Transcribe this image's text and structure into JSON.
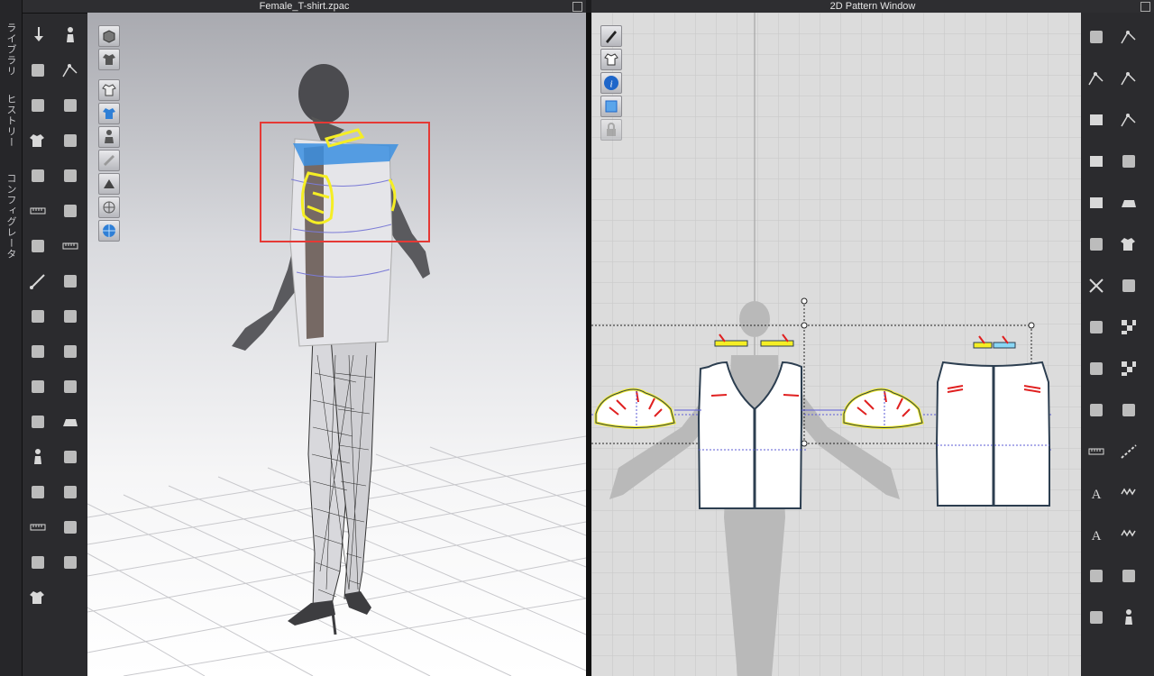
{
  "side_tabs": [
    {
      "label": "ライブラリ"
    },
    {
      "label": "ヒストリー"
    },
    {
      "label": "コンフィグレータ"
    }
  ],
  "windows": {
    "left_title": "Female_T-shirt.zpac",
    "right_title": "2D Pattern Window"
  },
  "colors": {
    "app_bg": "#1d1d1f",
    "toolbar_bg": "#2b2b2e",
    "selection_box": "#e53935",
    "seam_highlight": "#f5ee24",
    "pattern_fill": "#ffffff",
    "pattern_outline": "#2c3e50",
    "notch_red": "#e02020",
    "grid_bg": "#dcdcdc"
  },
  "left_toolbar_icons": [
    "move-down-icon",
    "walk-figure-icon",
    "pin-hand-icon",
    "transform-pattern-icon",
    "edit-pattern-icon",
    "tack-icon",
    "tshirt-icon",
    "fold-icon",
    "fold-arrangement-icon",
    "tape-icon",
    "measure-icon",
    "zip-icon",
    "sewing-machine-icon",
    "avatar-measure-icon",
    "needle-icon",
    "button-icon",
    "camera-icon",
    "buttonhole-icon",
    "select-mesh-icon",
    "lock-icon",
    "puckering-icon",
    "zipper-icon",
    "trim-icon",
    "press-icon",
    "avatar-size-icon",
    "solid-sheet-icon",
    "fold-line-icon",
    "topstitch-icon",
    "ruler-icon",
    "gradient-icon",
    "pocket-icon",
    "arrange-icon",
    "shirt-layer-icon"
  ],
  "right_toolbar_icons": [
    "select-move-icon",
    "transform-pattern-icon",
    "edit-point-icon",
    "add-point-icon",
    "polygon-icon",
    "curve-point-icon",
    "rectangle-icon",
    "internal-shape-icon",
    "internal-rect-icon",
    "iron-icon",
    "trace-icon",
    "tshirt-icon",
    "cut-icon",
    "fabric-icon",
    "fold-pattern-icon",
    "checker-icon",
    "notch-icon",
    "checker-icon-2",
    "segment-sew-icon",
    "topstitch-line-icon",
    "ruler-icon",
    "dashed-line-icon",
    "text-a-icon",
    "zigzag-icon",
    "text-a-large-icon",
    "wave-stitch-icon",
    "barcode-icon",
    "add-pattern-icon",
    "fold-arrangement-icon",
    "avatar-pin-icon"
  ],
  "viewport3d_tools": [
    "cube-icon",
    "shirt-icon",
    "shirt-texture-icon",
    "shirt-highlight-icon",
    "avatar-icon",
    "fabric-surface-icon",
    "fold-icon",
    "mesh-icon",
    "globe-icon"
  ],
  "viewport2d_tools": [
    "pen-icon",
    "shirt-icon",
    "info-icon",
    "layers-icon",
    "lock-icon"
  ]
}
